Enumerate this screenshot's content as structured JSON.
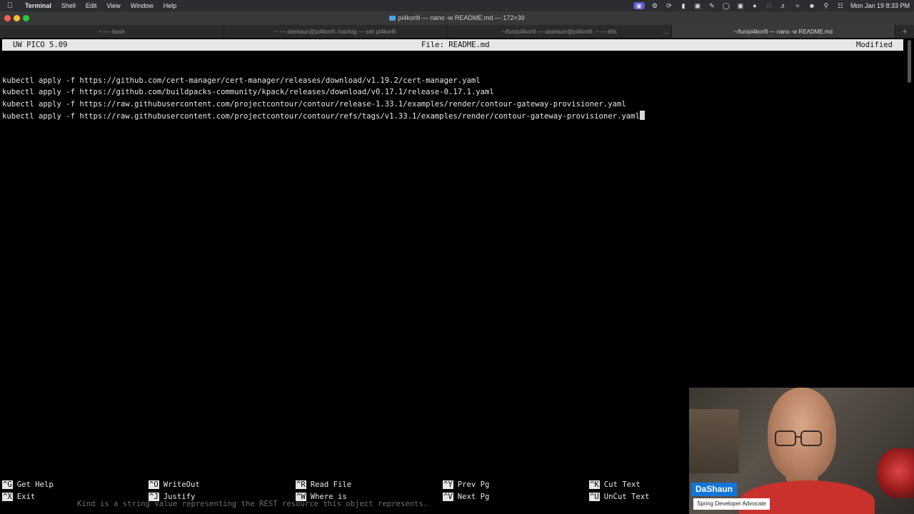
{
  "menubar": {
    "apple_icon": "apple-logo",
    "app_name": "Terminal",
    "menus": [
      "Shell",
      "Edit",
      "View",
      "Window",
      "Help"
    ],
    "clock": "Mon Jan 19  8:33 PM"
  },
  "window": {
    "title": "pi4korifi — nano -w README.md — 172×39"
  },
  "tabs": [
    {
      "label": "~ — -bash"
    },
    {
      "label": "~ — dashaun@pi4korifi: /var/log — ssh pi4korifi"
    },
    {
      "label": "~/fun/pi4korifi — dashaun@pi4korifi: ~ — k9s"
    },
    {
      "label": "~/fun/pi4korifi — nano -w README.md"
    }
  ],
  "tab_more": "...",
  "new_tab": "+",
  "nano": {
    "version": "UW PICO 5.09",
    "file": "File: README.md",
    "status": "Modified",
    "lines": [
      "",
      "kubectl apply -f https://github.com/cert-manager/cert-manager/releases/download/v1.19.2/cert-manager.yaml",
      "kubectl apply -f https://github.com/buildpacks-community/kpack/releases/download/v0.17.1/release-0.17.1.yaml",
      "kubectl apply -f https://raw.githubusercontent.com/projectcontour/contour/release-1.33.1/examples/render/contour-gateway-provisioner.yaml",
      "kubectl apply -f https://raw.githubusercontent.com/projectcontour/contour/refs/tags/v1.33.1/examples/render/contour-gateway-provisioner.yaml"
    ],
    "shortcuts": [
      {
        "key": "^G",
        "label": "Get Help"
      },
      {
        "key": "^X",
        "label": "Exit"
      },
      {
        "key": "^O",
        "label": "WriteOut"
      },
      {
        "key": "^J",
        "label": "Justify"
      },
      {
        "key": "^R",
        "label": "Read File"
      },
      {
        "key": "^W",
        "label": "Where is"
      },
      {
        "key": "^Y",
        "label": "Prev Pg"
      },
      {
        "key": "^V",
        "label": "Next Pg"
      },
      {
        "key": "^K",
        "label": "Cut Text"
      },
      {
        "key": "^U",
        "label": "UnCut Text"
      }
    ],
    "ghost_text": "Kind is a string value representing the REST resource this object represents."
  },
  "webcam": {
    "name": "DaShaun",
    "role": "Spring Developer Advocate"
  },
  "colors": {
    "menubar_bg": "#2b2d31",
    "titlebar_bg": "#383838",
    "terminal_bg": "#000000",
    "terminal_fg": "#e8e8e8",
    "nano_bar_bg": "#e6e6e6",
    "badge_blue": "#1275d8"
  }
}
